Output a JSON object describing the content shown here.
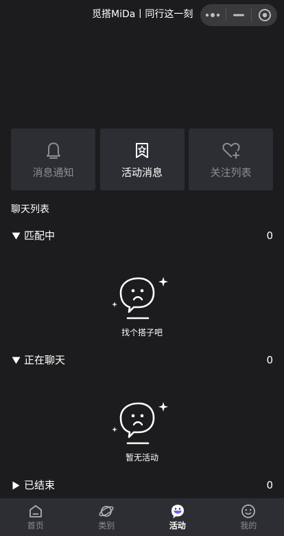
{
  "header": {
    "title": "觅搭MiDa丨同行这一刻",
    "capsule": {
      "more_icon": "more-dots-icon",
      "minimize_icon": "minus-icon",
      "close_icon": "target-circle-icon"
    }
  },
  "cards": [
    {
      "label": "消息通知",
      "icon": "bell-icon",
      "active": false
    },
    {
      "label": "活动消息",
      "icon": "star-bookmark-icon",
      "active": true
    },
    {
      "label": "关注列表",
      "icon": "heart-plus-icon",
      "active": false
    }
  ],
  "chat_list_title": "聊天列表",
  "groups": [
    {
      "label": "匹配中",
      "count": "0",
      "expanded": true,
      "empty_text": "找个搭子吧"
    },
    {
      "label": "正在聊天",
      "count": "0",
      "expanded": true,
      "empty_text": "暂无活动"
    },
    {
      "label": "已结束",
      "count": "0",
      "expanded": false
    }
  ],
  "tabbar": [
    {
      "label": "首页",
      "icon": "home-icon",
      "active": false
    },
    {
      "label": "类别",
      "icon": "planet-icon",
      "active": false
    },
    {
      "label": "活动",
      "icon": "chat-bubble-icon",
      "active": true
    },
    {
      "label": "我的",
      "icon": "face-icon",
      "active": false
    }
  ],
  "colors": {
    "background": "#1c1c1e",
    "card": "#2c2e33",
    "accent": "#7b5cf5",
    "muted": "#8e8e93"
  }
}
